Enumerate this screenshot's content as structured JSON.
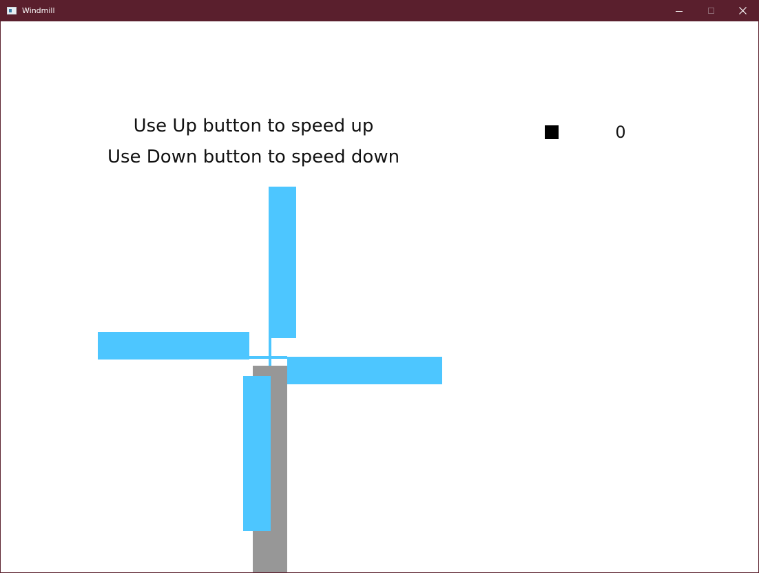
{
  "window": {
    "title": "Windmill",
    "app_icon": "window-app-icon",
    "controls": {
      "minimize_icon": "minimize-icon",
      "maximize_icon": "maximize-icon",
      "close_icon": "close-icon"
    }
  },
  "instructions": {
    "line1": "Use Up button to speed up",
    "line2": "Use Down button to speed down"
  },
  "speed": {
    "value": "0"
  },
  "colors": {
    "titlebar": "#5a1f2d",
    "blade": "#4dc6ff",
    "tower": "#979797",
    "swatch": "#000000",
    "background": "#ffffff"
  }
}
